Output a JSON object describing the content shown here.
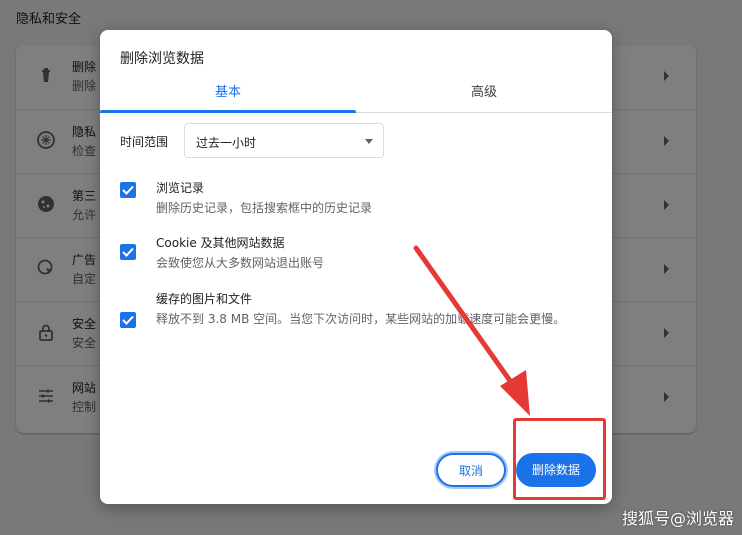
{
  "settings_page": {
    "section_title": "隐私和安全",
    "rows": [
      {
        "icon": "trash-icon",
        "line1": "删除",
        "line2": "删除"
      },
      {
        "icon": "safety-check-icon",
        "line1": "隐私",
        "line2": "检查"
      },
      {
        "icon": "cookie-icon",
        "line1": "第三",
        "line2": "允许"
      },
      {
        "icon": "ads-icon",
        "line1": "广告",
        "line2": "自定"
      },
      {
        "icon": "lock-icon",
        "line1": "安全",
        "line2": "安全"
      },
      {
        "icon": "tune-icon",
        "line1": "网站",
        "line2": "控制"
      }
    ]
  },
  "dialog": {
    "title": "删除浏览数据",
    "tabs": [
      {
        "label": "基本",
        "active": true
      },
      {
        "label": "高级",
        "active": false
      }
    ],
    "time_range": {
      "label": "时间范围",
      "value": "过去一小时"
    },
    "options": [
      {
        "title": "浏览记录",
        "subtitle": "删除历史记录，包括搜索框中的历史记录",
        "checked": true
      },
      {
        "title": "Cookie 及其他网站数据",
        "subtitle": "会致使您从大多数网站退出账号",
        "checked": true
      },
      {
        "title": "缓存的图片和文件",
        "subtitle": "释放不到 3.8 MB 空间。当您下次访问时，某些网站的加载速度可能会更慢。",
        "checked": true
      }
    ],
    "cancel_label": "取消",
    "delete_label": "删除数据"
  },
  "watermark": "搜狐号@浏览器",
  "colors": {
    "accent": "#1a73e8",
    "annotation": "#e53935",
    "scrim": "rgba(0,0,0,0.5)"
  }
}
